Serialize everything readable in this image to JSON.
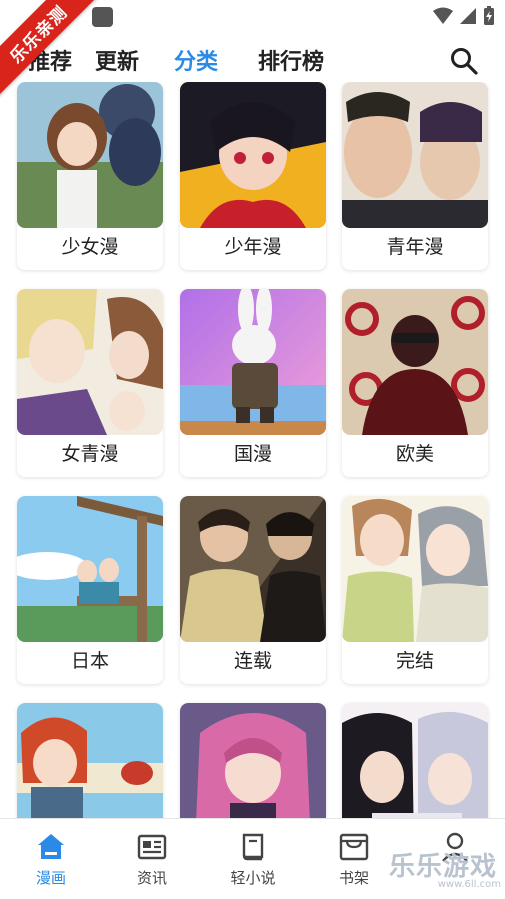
{
  "ribbon": {
    "text": "乐乐亲测"
  },
  "top_tabs": [
    "推荐",
    "更新",
    "分类",
    "排行榜"
  ],
  "active_tab": "分类",
  "accent_color": "#2a8ae6",
  "categories": [
    "少女漫",
    "少年漫",
    "青年漫",
    "女青漫",
    "国漫",
    "欧美",
    "日本",
    "连载",
    "完结",
    "",
    "",
    ""
  ],
  "bottom_nav": [
    {
      "label": "漫画",
      "icon": "home-icon"
    },
    {
      "label": "资讯",
      "icon": "news-icon"
    },
    {
      "label": "轻小说",
      "icon": "book-icon"
    },
    {
      "label": "书架",
      "icon": "bookshelf-icon"
    },
    {
      "label": "",
      "icon": "profile-icon"
    }
  ],
  "watermark": {
    "text": "乐乐游戏",
    "url": "www.6ll.com"
  }
}
